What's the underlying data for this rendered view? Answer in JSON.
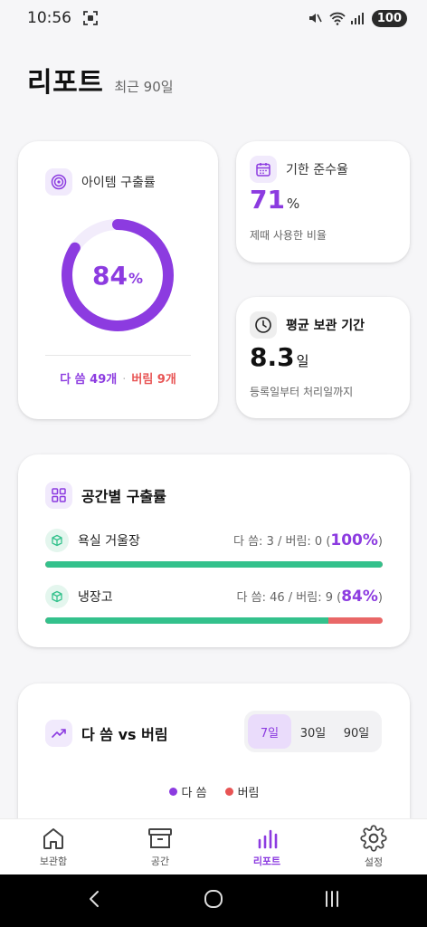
{
  "status_bar": {
    "time": "10:56",
    "battery": "100"
  },
  "header": {
    "title": "리포트",
    "subtitle": "최근 90일"
  },
  "rate_card": {
    "label": "아이템 구출률",
    "value": "84",
    "unit": "%",
    "progress": 0.84,
    "used_text": "다 씀 49개",
    "separator": "·",
    "wasted_text": "버림 9개"
  },
  "deadline_card": {
    "label": "기한 준수율",
    "value": "71",
    "unit": "%",
    "desc": "제때 사용한 비율"
  },
  "period_card": {
    "label": "평균 보관 기간",
    "value": "8.3",
    "unit": "일",
    "desc": "등록일부터 처리일까지"
  },
  "space_card": {
    "title": "공간별 구출률",
    "rows": [
      {
        "name": "욕실 거울장",
        "stats_prefix": "다 씀: 3 / 버림: 0 (",
        "pct": "100%",
        "stats_suffix": ")",
        "fill": 1.0
      },
      {
        "name": "냉장고",
        "stats_prefix": "다 씀: 46 / 버림: 9 (",
        "pct": "84%",
        "stats_suffix": ")",
        "fill": 0.84
      }
    ]
  },
  "trend_card": {
    "title": "다 씀 vs 버림",
    "tabs": [
      "7일",
      "30일",
      "90일"
    ],
    "active_tab": "7일",
    "legend": [
      {
        "label": "다 씀",
        "color": "#8c3be0"
      },
      {
        "label": "버림",
        "color": "#e85454"
      }
    ]
  },
  "bottom_nav": {
    "items": [
      "보관함",
      "공간",
      "리포트",
      "설정"
    ],
    "active": "리포트"
  },
  "colors": {
    "accent": "#8c3be0",
    "danger": "#e85454",
    "success": "#33c18c"
  }
}
